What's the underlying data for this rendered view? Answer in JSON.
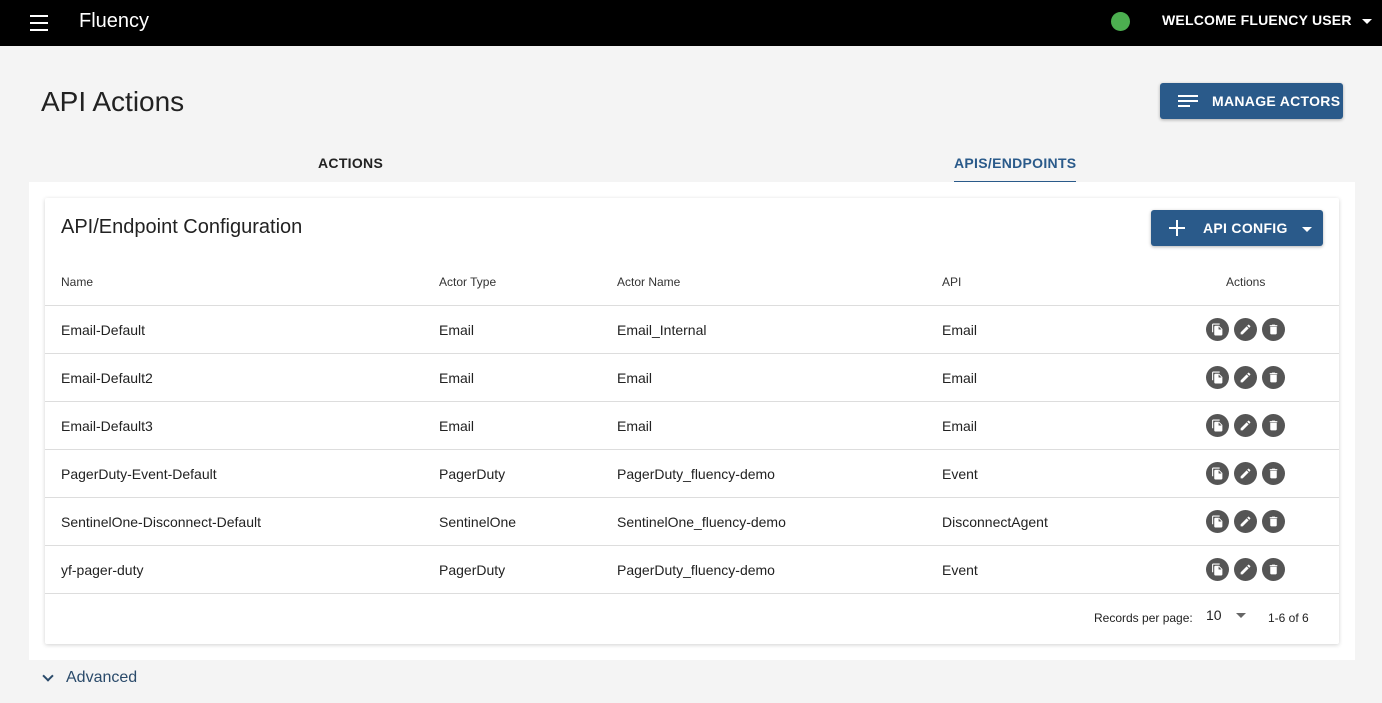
{
  "appbar": {
    "title": "Fluency",
    "welcome": "WELCOME FLUENCY USER",
    "status_color": "#4caf50"
  },
  "page": {
    "title": "API Actions",
    "manage_label": "MANAGE ACTORS"
  },
  "tabs": [
    {
      "label": "ACTIONS",
      "active": false
    },
    {
      "label": "APIS/ENDPOINTS",
      "active": true
    }
  ],
  "card": {
    "title": "API/Endpoint Configuration",
    "config_label": "API CONFIG",
    "columns": [
      "Name",
      "Actor Type",
      "Actor Name",
      "API",
      "Actions"
    ],
    "rows": [
      {
        "name": "Email-Default",
        "type": "Email",
        "actor": "Email_Internal",
        "api": "Email"
      },
      {
        "name": "Email-Default2",
        "type": "Email",
        "actor": "Email",
        "api": "Email"
      },
      {
        "name": "Email-Default3",
        "type": "Email",
        "actor": "Email",
        "api": "Email"
      },
      {
        "name": "PagerDuty-Event-Default",
        "type": "PagerDuty",
        "actor": "PagerDuty_fluency-demo",
        "api": "Event"
      },
      {
        "name": "SentinelOne-Disconnect-Default",
        "type": "SentinelOne",
        "actor": "SentinelOne_fluency-demo",
        "api": "DisconnectAgent"
      },
      {
        "name": "yf-pager-duty",
        "type": "PagerDuty",
        "actor": "PagerDuty_fluency-demo",
        "api": "Event"
      }
    ],
    "footer": {
      "rpp_label": "Records per page:",
      "rpp_value": "10",
      "range": "1-6 of 6"
    }
  },
  "advanced_label": "Advanced",
  "colors": {
    "primary": "#2a5a8a",
    "appbar": "#000000",
    "action_icon_bg": "#555555"
  }
}
